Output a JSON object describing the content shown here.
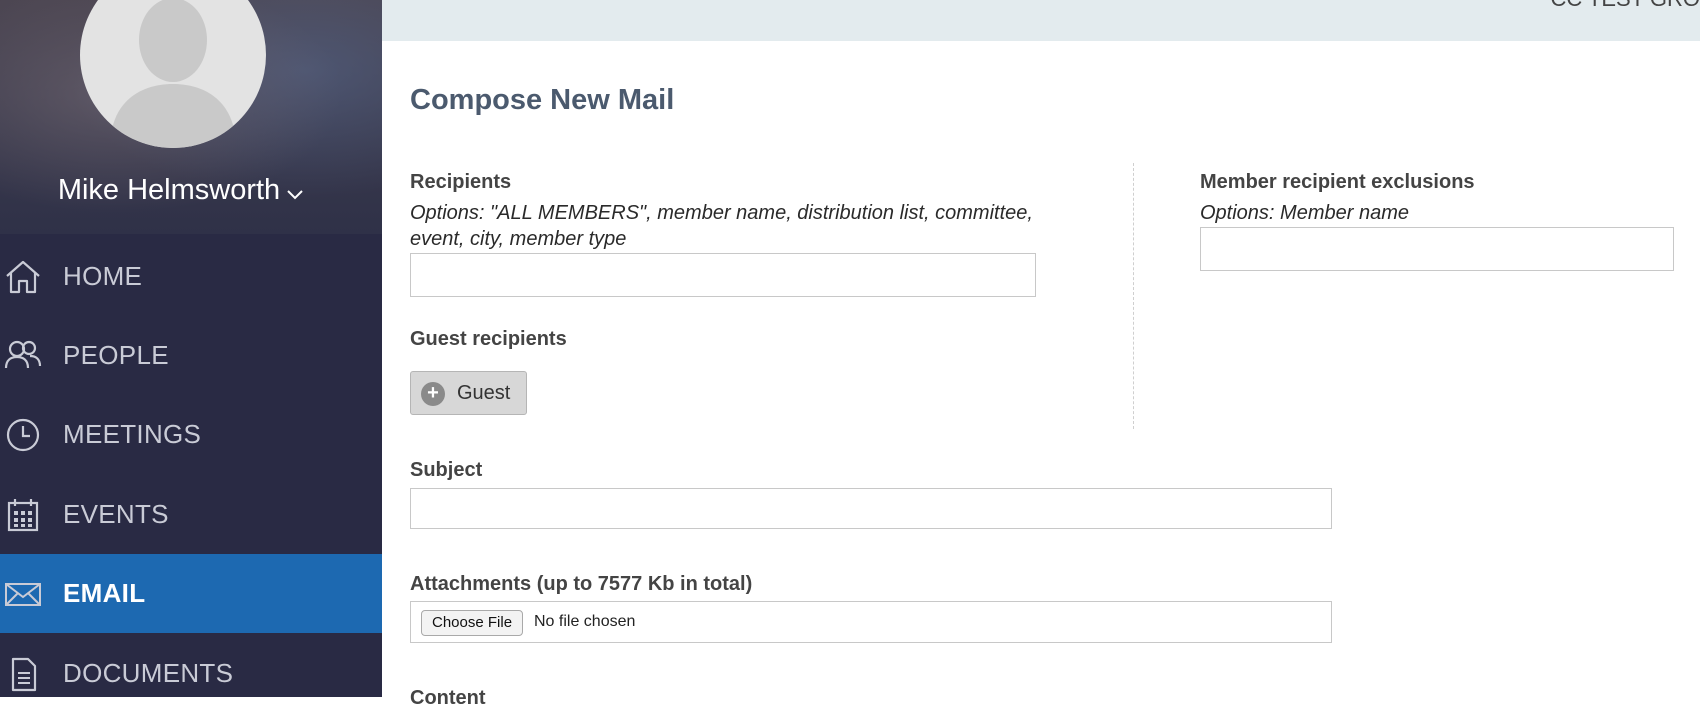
{
  "user": {
    "name": "Mike Helmsworth"
  },
  "topbar": {
    "text": "CC TEST GRO"
  },
  "nav": [
    {
      "label": "HOME",
      "icon": "home-icon",
      "active": false
    },
    {
      "label": "PEOPLE",
      "icon": "people-icon",
      "active": false
    },
    {
      "label": "MEETINGS",
      "icon": "clock-icon",
      "active": false
    },
    {
      "label": "EVENTS",
      "icon": "calendar-icon",
      "active": false
    },
    {
      "label": "EMAIL",
      "icon": "envelope-icon",
      "active": true
    },
    {
      "label": "DOCUMENTS",
      "icon": "document-icon",
      "active": false
    }
  ],
  "form": {
    "title": "Compose New Mail",
    "recipients": {
      "label": "Recipients",
      "hint": "Options: \"ALL MEMBERS\", member name, distribution list, committee, event, city, member type",
      "value": ""
    },
    "exclusions": {
      "label": "Member recipient exclusions",
      "hint": "Options: Member name",
      "value": ""
    },
    "guest": {
      "label": "Guest recipients",
      "button_label": "Guest"
    },
    "subject": {
      "label": "Subject",
      "value": ""
    },
    "attachments": {
      "label": "Attachments (up to 7577 Kb in total)",
      "choose_label": "Choose File",
      "status": "No file chosen"
    },
    "content": {
      "label": "Content"
    }
  },
  "colors": {
    "sidebar_bg": "#292a44",
    "active_bg": "#1d69b1",
    "topbar_bg": "#e3ebee",
    "title": "#4b5a6e"
  }
}
